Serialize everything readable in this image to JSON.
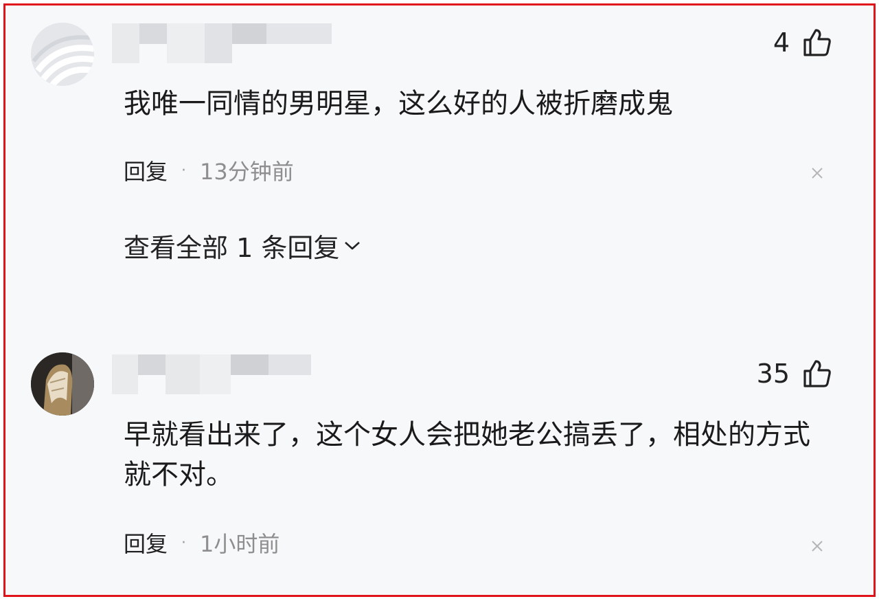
{
  "comments": [
    {
      "likes": "4",
      "text": "我唯一同情的男明星，这么好的人被折磨成鬼",
      "reply_label": "回复",
      "separator": "·",
      "time": "13分钟前",
      "view_replies": "查看全部 1 条回复",
      "avatar_icon": "swirl-avatar-icon"
    },
    {
      "likes": "35",
      "text": "早就看出来了，这个女人会把她老公搞丢了，相处的方式就不对。",
      "reply_label": "回复",
      "separator": "·",
      "time": "1小时前",
      "avatar_icon": "portrait-avatar-icon"
    }
  ],
  "colors": {
    "frame_border": "#e0131a",
    "background": "#f7f8fa",
    "muted_text": "#8e8e8e"
  }
}
